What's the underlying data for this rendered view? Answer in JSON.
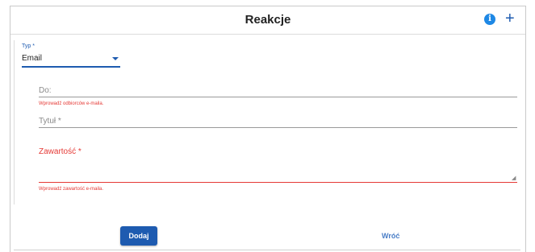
{
  "header": {
    "title": "Reakcje",
    "info_icon": "i",
    "add_icon": "+"
  },
  "form": {
    "typ": {
      "label": "Typ *",
      "value": "Email"
    },
    "do": {
      "label": "Do:",
      "error": "Wprowadź odbiorców e-maila."
    },
    "tytul": {
      "label": "Tytuł *"
    },
    "zawartosc": {
      "label": "Zawartość *",
      "error": "Wprowadź zawartość e-maila."
    }
  },
  "actions": {
    "add_label": "Dodaj",
    "back_label": "Wróć"
  },
  "colors": {
    "primary": "#1e5bb0",
    "error": "#e53935",
    "info": "#1e88e5"
  }
}
